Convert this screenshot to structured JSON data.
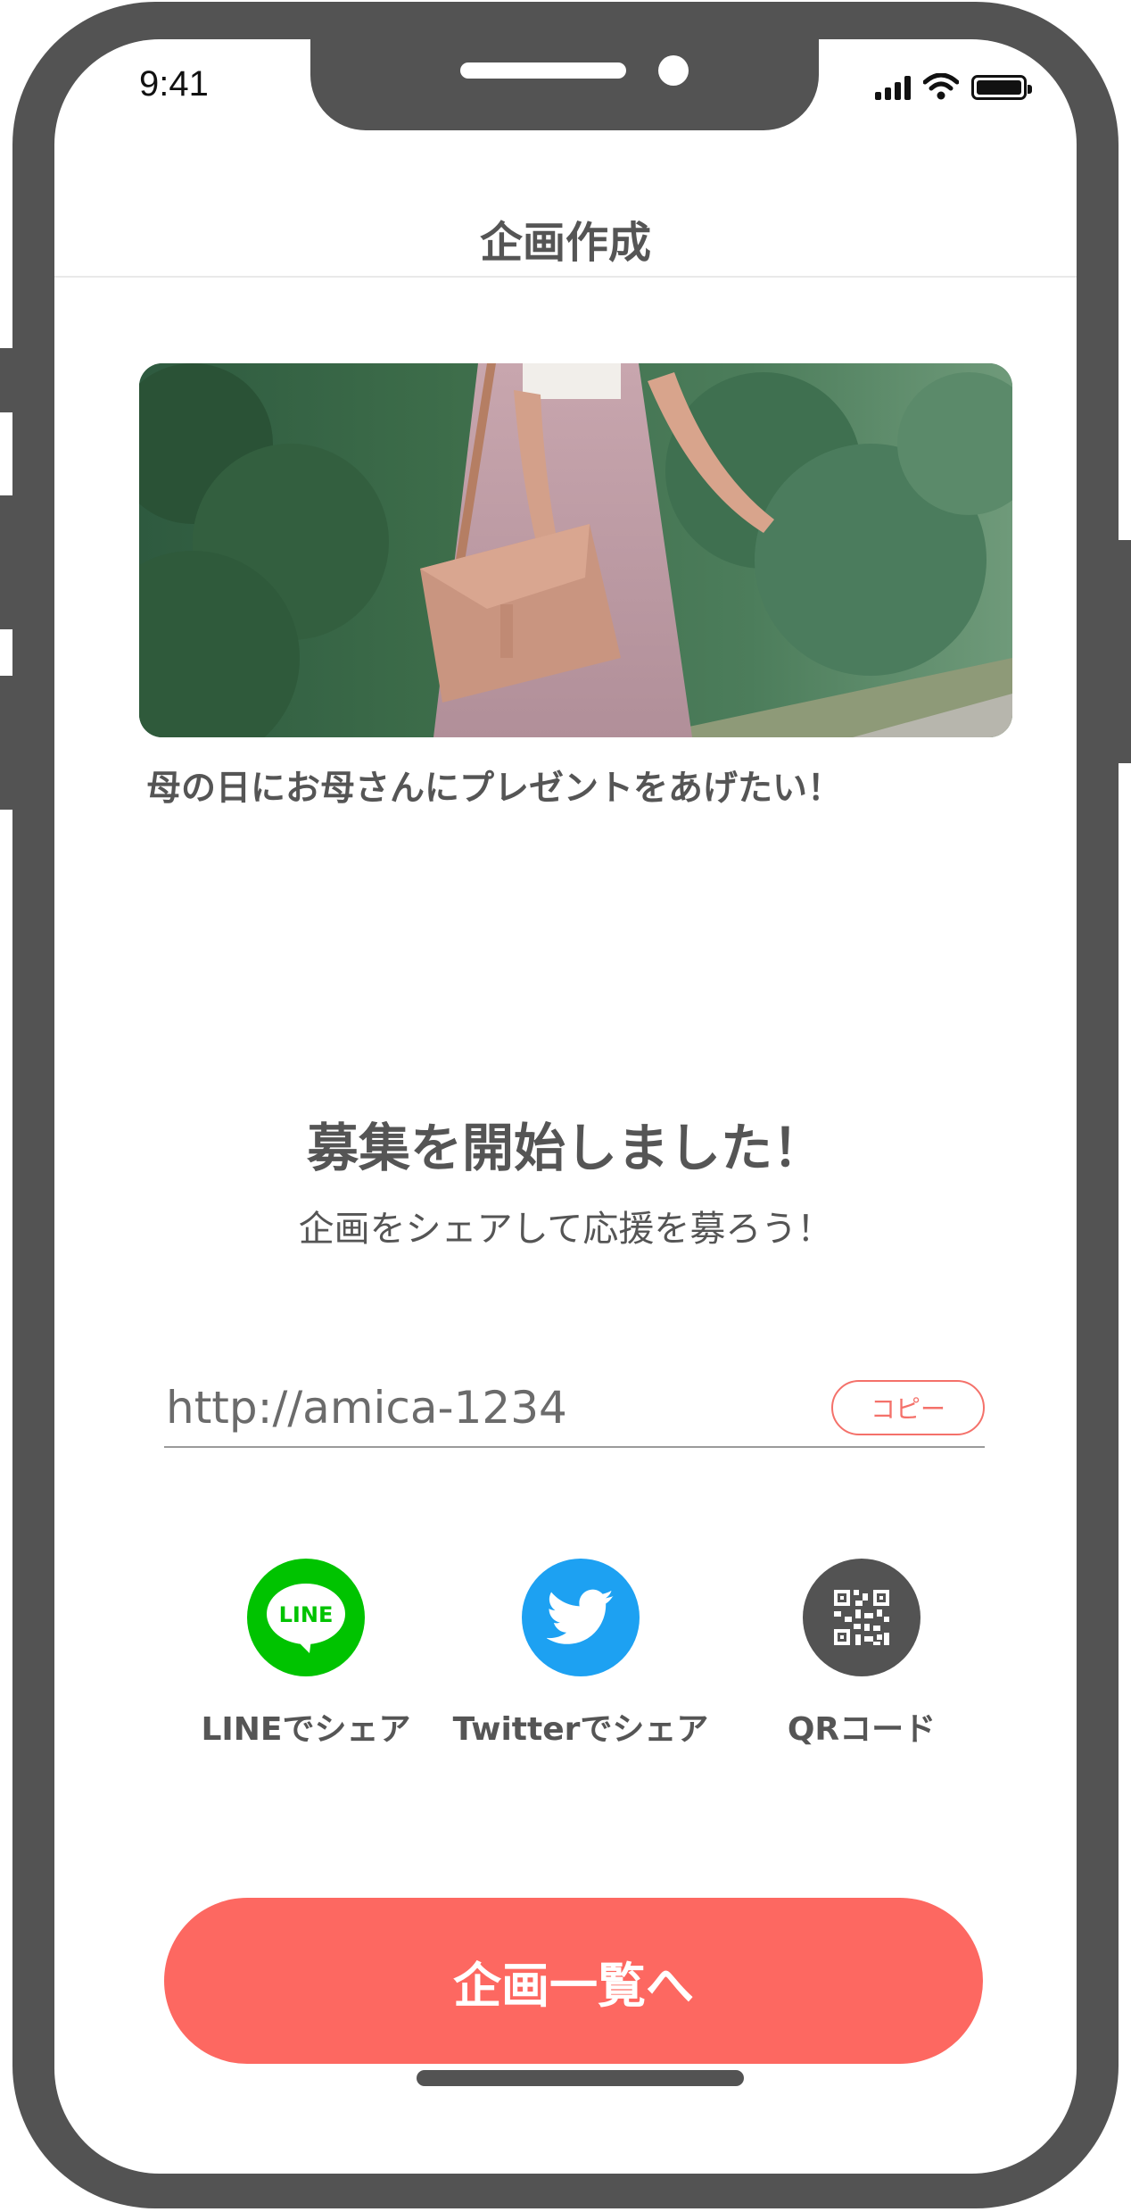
{
  "status_bar": {
    "time": "9:41"
  },
  "header": {
    "title": "企画作成"
  },
  "project": {
    "caption": "母の日にお母さんにプレゼントをあげたい！"
  },
  "message": {
    "title": "募集を開始しました！",
    "subtitle": "企画をシェアして応援を募ろう！"
  },
  "share_url": {
    "value": "http://amica-1234",
    "copy_label": "コピー"
  },
  "share_options": [
    {
      "label": "LINEでシェア",
      "icon": "line-icon",
      "badge_text": "LINE",
      "color": "#00c300"
    },
    {
      "label": "Twitterでシェア",
      "icon": "twitter-bird-icon",
      "color": "#1da1f2"
    },
    {
      "label": "QRコード",
      "icon": "qr-code-icon",
      "color": "#535353"
    }
  ],
  "primary_button": {
    "label": "企画一覧へ",
    "color": "#fd6861"
  },
  "colors": {
    "frame": "#535353",
    "text": "#555555",
    "accent": "#f4716a"
  }
}
